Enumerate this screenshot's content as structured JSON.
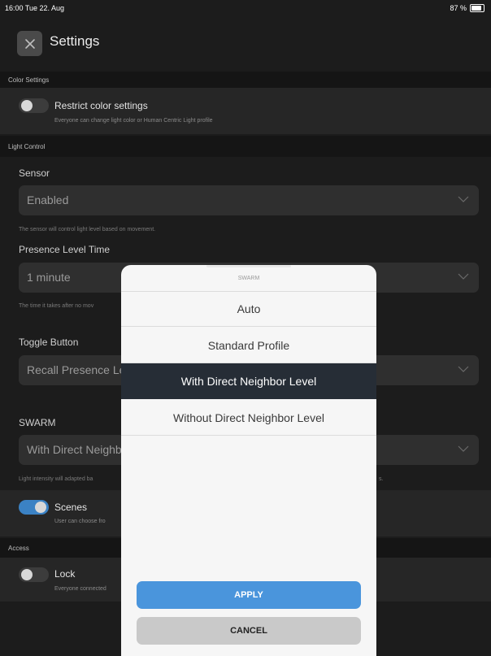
{
  "status": {
    "time": "16:00  Tue 22. Aug",
    "battery": "87 %"
  },
  "header": {
    "title": "Settings",
    "close_icon": "close-icon"
  },
  "sections": {
    "color": "Color Settings",
    "light": "Light Control",
    "access": "Access"
  },
  "color_settings": {
    "label": "Restrict color settings",
    "sub": "Everyone can change light color or Human Centric Light profile",
    "enabled": false
  },
  "sensor": {
    "label": "Sensor",
    "value": "Enabled",
    "hint": "The sensor will control light level based on movement."
  },
  "presence": {
    "label": "Presence Level Time",
    "value": "1 minute",
    "hint": "The time it takes after no mov"
  },
  "toggle_button": {
    "label": "Toggle Button",
    "value": "Recall Presence Le"
  },
  "swarm": {
    "label": "SWARM",
    "value": "With Direct Neighb",
    "hint": "Light intensity will adapted ba",
    "hint_tail": "s."
  },
  "scenes": {
    "label": "Scenes",
    "sub": "User can choose fro",
    "enabled": true
  },
  "lock": {
    "label": "Lock",
    "sub": "Everyone connected",
    "enabled": false
  },
  "sheet": {
    "title": "SWARM",
    "options": [
      "Auto",
      "Standard Profile",
      "With Direct Neighbor Level",
      "Without Direct Neighbor Level"
    ],
    "selected": "With Direct Neighbor Level",
    "apply": "APPLY",
    "cancel": "CANCEL"
  },
  "colors": {
    "accent": "#4a95dc",
    "toggle_on": "#3b82c4",
    "selected_bg": "#262d36"
  }
}
